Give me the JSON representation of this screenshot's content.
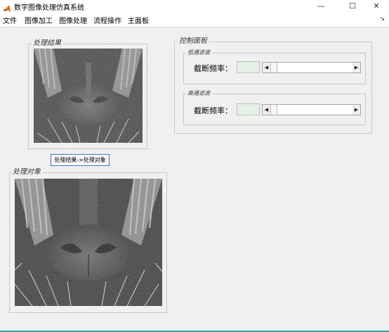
{
  "window": {
    "title": "数字图像处理仿真系统",
    "controls": {
      "minimize": "—",
      "maximize": "☐",
      "close": "✕"
    }
  },
  "menu": {
    "items": [
      "文件",
      "图像加工",
      "图像处理",
      "流程操作",
      "主面板"
    ],
    "dock": "↘"
  },
  "result_panel": {
    "title": "处理结果"
  },
  "copy_button": {
    "label": "处理结果->处理对象"
  },
  "source_panel": {
    "title": "处理对象"
  },
  "control_panel": {
    "title": "控制面板",
    "lowpass": {
      "title": "低通滤波",
      "cutoff_label": "截断频率：",
      "value": "",
      "slider_level": 0
    },
    "highpass": {
      "title": "高通滤波",
      "cutoff_label": "截断频率：",
      "value": "",
      "slider_level": 0
    }
  },
  "arrows": {
    "left": "◀",
    "right": "▶"
  },
  "colors": {
    "accent": "#3c78c8",
    "edit_bg": "#e6f0e6",
    "taskbar": "#2aa6a0"
  }
}
